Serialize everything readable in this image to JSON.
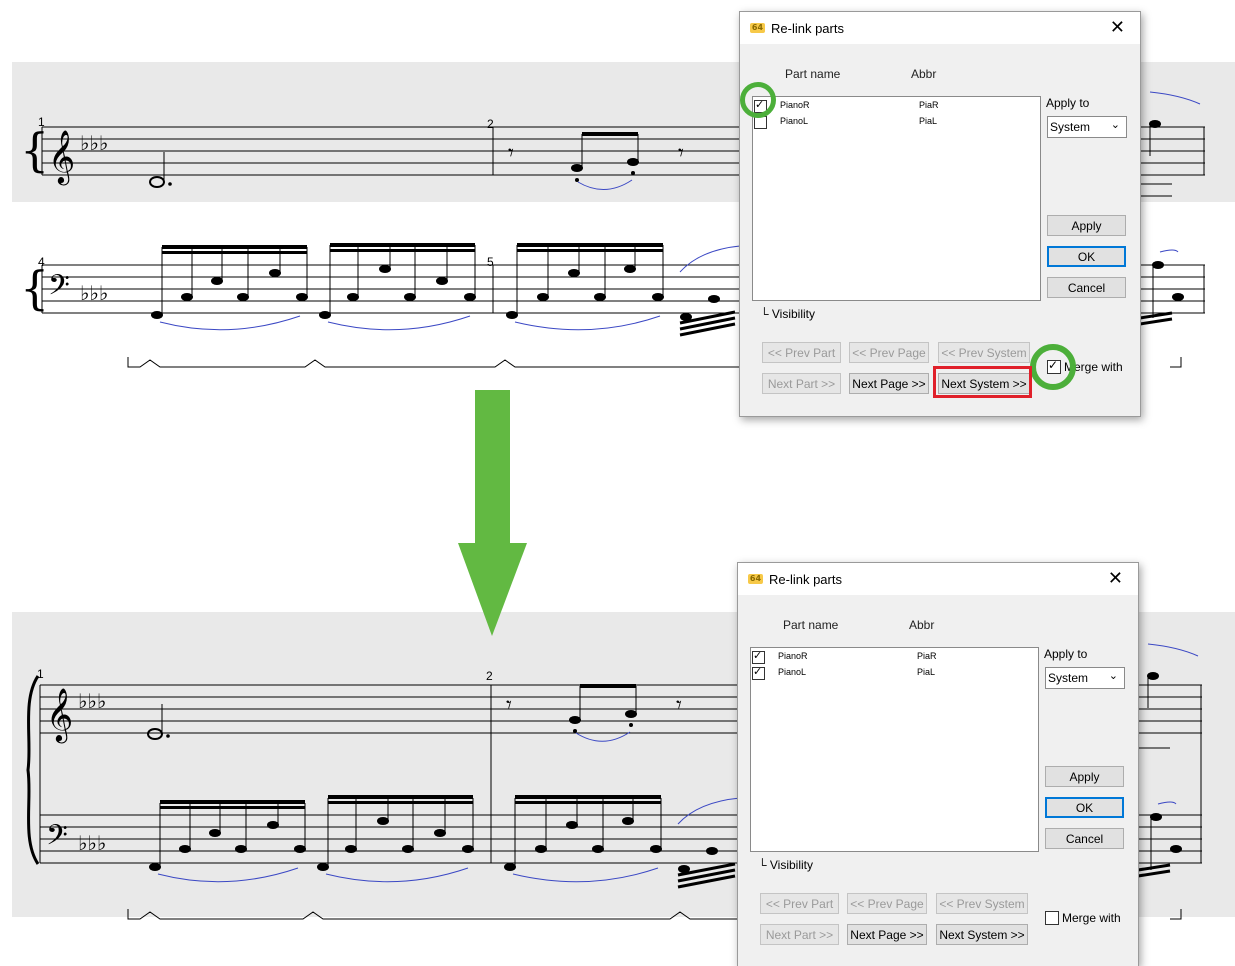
{
  "top_panel": {
    "dialog": {
      "title": "Re-link parts",
      "close_glyph": "✕",
      "icon_label": "64",
      "columns": {
        "part_name": "Part name",
        "abbr": "Abbr"
      },
      "parts": [
        {
          "name": "PianoR",
          "abbr": "PiaR",
          "checked": true
        },
        {
          "name": "PianoL",
          "abbr": "PiaL",
          "checked": false
        }
      ],
      "apply_to_label": "Apply to",
      "apply_to_value": "System",
      "buttons": {
        "apply": "Apply",
        "ok": "OK",
        "cancel": "Cancel"
      },
      "visibility_label": "Visibility",
      "nav": {
        "prev_part": "<< Prev Part",
        "prev_page": "<< Prev Page",
        "prev_system": "<< Prev System",
        "next_part": "Next Part >>",
        "next_page": "Next Page >>",
        "next_system": "Next System >>"
      },
      "merge_with_label": "Merge with",
      "merge_with_checked": true
    },
    "score": {
      "measure_numbers": [
        "1",
        "2",
        "4",
        "5"
      ]
    }
  },
  "bottom_panel": {
    "dialog": {
      "title": "Re-link parts",
      "close_glyph": "✕",
      "icon_label": "64",
      "columns": {
        "part_name": "Part name",
        "abbr": "Abbr"
      },
      "parts": [
        {
          "name": "PianoR",
          "abbr": "PiaR",
          "checked": true
        },
        {
          "name": "PianoL",
          "abbr": "PiaL",
          "checked": true
        }
      ],
      "apply_to_label": "Apply to",
      "apply_to_value": "System",
      "buttons": {
        "apply": "Apply",
        "ok": "OK",
        "cancel": "Cancel"
      },
      "visibility_label": "Visibility",
      "nav": {
        "prev_part": "<< Prev Part",
        "prev_page": "<< Prev Page",
        "prev_system": "<< Prev System",
        "next_part": "Next Part >>",
        "next_page": "Next Page >>",
        "next_system": "Next System >>"
      },
      "merge_with_label": "Merge with",
      "merge_with_checked": false
    },
    "score": {
      "measure_numbers": [
        "1",
        "2"
      ]
    }
  },
  "colors": {
    "highlight_green": "#4caf3a",
    "highlight_red": "#e0202a",
    "arrow_green": "#62b942",
    "slur_blue": "#3b48c4",
    "band_gray": "#e9e9e9"
  }
}
